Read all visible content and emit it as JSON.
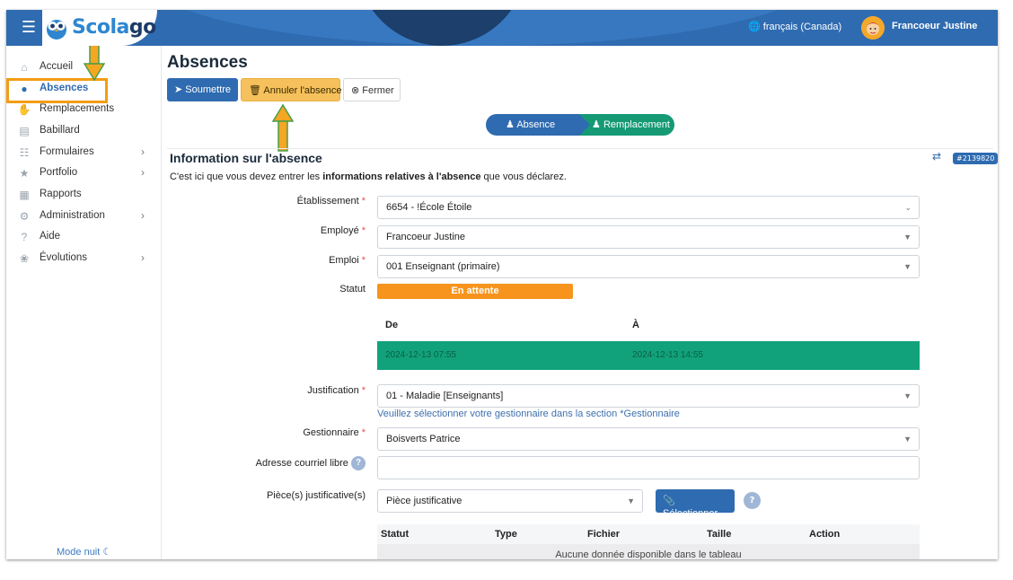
{
  "header": {
    "brand_part1": "Scola",
    "brand_part2": "go",
    "language": "français (Canada)",
    "user_name": "Francoeur Justine"
  },
  "sidebar": {
    "items": [
      {
        "label": "Accueil",
        "icon": "home-icon"
      },
      {
        "label": "Absences",
        "icon": "user-clock-icon",
        "active": true
      },
      {
        "label": "Remplacements",
        "icon": "handshake-icon"
      },
      {
        "label": "Babillard",
        "icon": "board-icon"
      },
      {
        "label": "Formulaires",
        "icon": "form-icon",
        "has_children": true
      },
      {
        "label": "Portfolio",
        "icon": "trophy-icon",
        "has_children": true
      },
      {
        "label": "Rapports",
        "icon": "report-icon"
      },
      {
        "label": "Administration",
        "icon": "gear-icon",
        "has_children": true
      },
      {
        "label": "Aide",
        "icon": "question-icon"
      },
      {
        "label": "Évolutions",
        "icon": "sprout-icon",
        "has_children": true
      }
    ],
    "night_mode": "Mode nuit"
  },
  "page": {
    "title": "Absences",
    "buttons": {
      "submit": "Soumettre",
      "cancel_absence": "Annuler l'absence",
      "close": "Fermer"
    },
    "steps": [
      "Absence",
      "Remplacement"
    ],
    "section_title": "Information sur l'absence",
    "section_desc_before": "C'est ici que vous devez entrer les ",
    "section_desc_bold": "informations relatives à l'absence",
    "section_desc_after": " que vous déclarez.",
    "record_id": "#2139820"
  },
  "form": {
    "etablissement": {
      "label": "Établissement",
      "value": "6654 - !École Étoile"
    },
    "employe": {
      "label": "Employé",
      "value": "Francoeur Justine"
    },
    "emploi": {
      "label": "Emploi",
      "value": "001 Enseignant (primaire)"
    },
    "statut": {
      "label": "Statut",
      "value": "En attente"
    },
    "period": {
      "from_header": "De",
      "to_header": "À",
      "from": "2024-12-13 07:55",
      "to": "2024-12-13 14:55"
    },
    "justification": {
      "label": "Justification",
      "value": "01 - Maladie [Enseignants]"
    },
    "gestionnaire_hint": "Veuillez sélectionner votre gestionnaire dans la section *Gestionnaire",
    "gestionnaire": {
      "label": "Gestionnaire",
      "value": "Boisverts Patrice"
    },
    "email": {
      "label": "Adresse courriel libre",
      "value": ""
    },
    "pieces": {
      "label": "Pièce(s) justificative(s)",
      "value": "Pièce justificative",
      "select_button": "Sélectionner"
    },
    "table": {
      "columns": [
        "Statut",
        "Type",
        "Fichier",
        "Taille",
        "Action"
      ],
      "empty": "Aucune donnée disponible dans le tableau"
    }
  },
  "colors": {
    "primary": "#2f6bb0",
    "warning": "#f7941d",
    "success": "#11a27b",
    "annotation": "#f39c12"
  }
}
